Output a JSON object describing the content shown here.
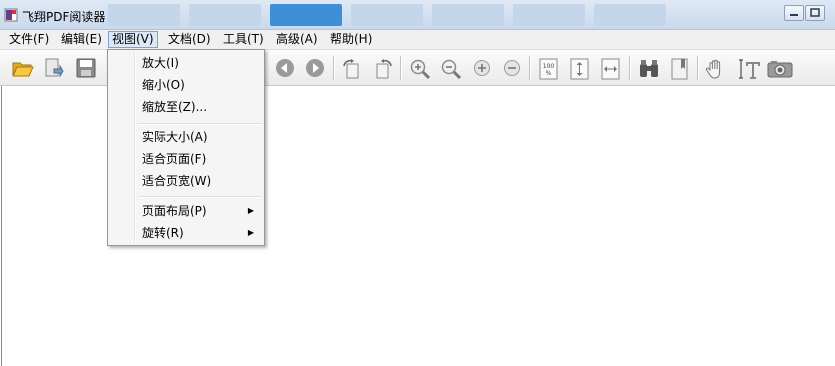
{
  "window": {
    "title": "飞翔PDF阅读器"
  },
  "menu": [
    {
      "label": "文件(F)"
    },
    {
      "label": "编辑(E)"
    },
    {
      "label": "视图(V)"
    },
    {
      "label": "文档(D)"
    },
    {
      "label": "工具(T)"
    },
    {
      "label": "高级(A)"
    },
    {
      "label": "帮助(H)"
    }
  ],
  "view_menu": {
    "items": [
      {
        "label": "放大(I)"
      },
      {
        "label": "缩小(O)"
      },
      {
        "label": "缩放至(Z)..."
      },
      {
        "label": "实际大小(A)"
      },
      {
        "label": "适合页面(F)"
      },
      {
        "label": "适合页宽(W)"
      },
      {
        "label": "页面布局(P)",
        "arrow": "▶"
      },
      {
        "label": "旋转(R)",
        "arrow": "▶"
      }
    ]
  },
  "toolbar": {
    "icons": [
      "open-folder-icon",
      "export-icon",
      "save-icon",
      "previous-page-icon",
      "next-page-icon",
      "rotate-clockwise-icon",
      "rotate-counterclockwise-icon",
      "zoom-in-magnifier-icon",
      "zoom-out-magnifier-icon",
      "zoom-in-circle-icon",
      "zoom-out-circle-icon",
      "actual-size-icon",
      "fit-page-icon",
      "fit-width-icon",
      "find-binoculars-icon",
      "bookmark-icon",
      "hand-tool-icon",
      "text-select-icon",
      "snapshot-camera-icon"
    ],
    "actual_size_label": "100"
  },
  "colors": {
    "titlebar": "#c9d9ec",
    "active_tab": "#3f8fd6",
    "menu_highlight": "#dbe8f7"
  }
}
